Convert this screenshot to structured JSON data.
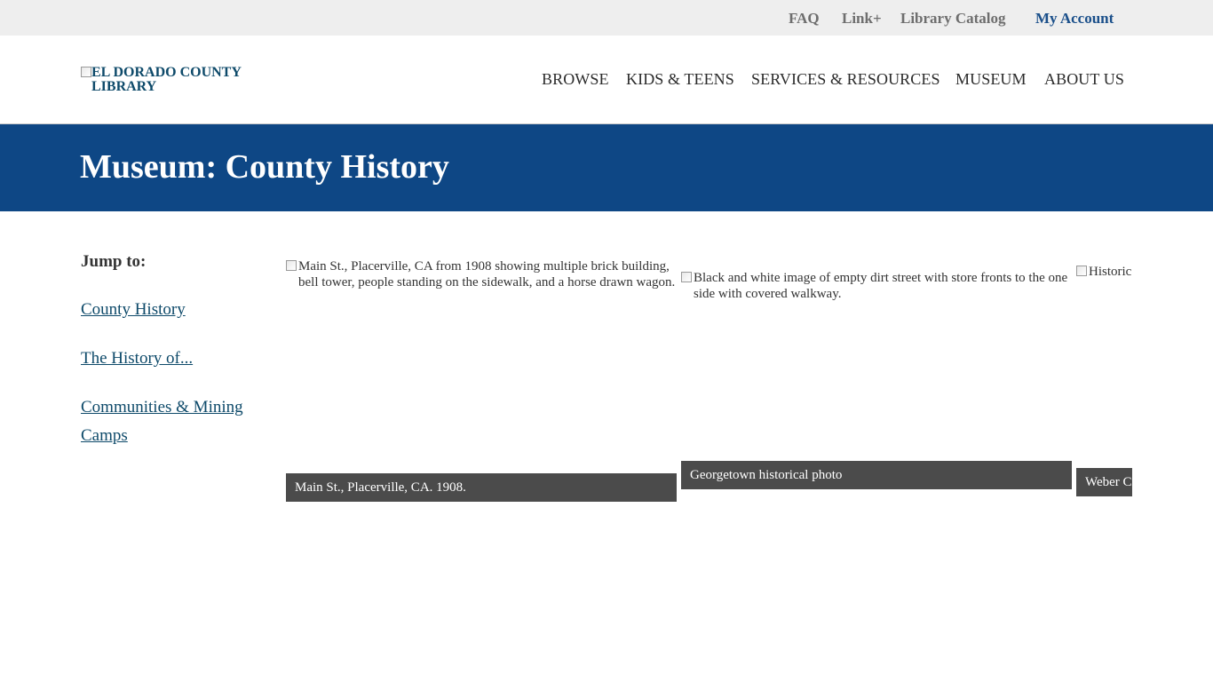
{
  "utility_nav": {
    "faq": "FAQ",
    "link_plus": "Link+",
    "catalog": "Library Catalog",
    "account": "My Account"
  },
  "header": {
    "logo_alt": "EL DORADO COUNTY LIBRARY",
    "nav": [
      "BROWSE",
      "KIDS & TEENS",
      "SERVICES & RESOURCES",
      "MUSEUM",
      "ABOUT US"
    ]
  },
  "banner": {
    "title": "Museum: County History"
  },
  "sidebar": {
    "jump_label": "Jump to:",
    "links": [
      "County History",
      "The History of...",
      "Communities & Mining Camps"
    ]
  },
  "gallery": {
    "items": [
      {
        "alt": "Main St., Placerville, CA from 1908 showing multiple brick building, bell tower, people standing on the sidewalk, and a horse drawn wagon.",
        "caption": "Main St., Placerville, CA. 1908."
      },
      {
        "alt": "Black and white image of empty dirt street with store fronts to the one side with covered walkway.",
        "caption": "Georgetown historical photo"
      },
      {
        "alt": "Historic photo of the Weber Creek",
        "caption": "Weber Creek"
      }
    ]
  },
  "colors": {
    "banner": "#0e4785",
    "link": "#0e4a6a",
    "caption_bg": "#4b4b4b",
    "utility_bg": "#eeeeee"
  }
}
